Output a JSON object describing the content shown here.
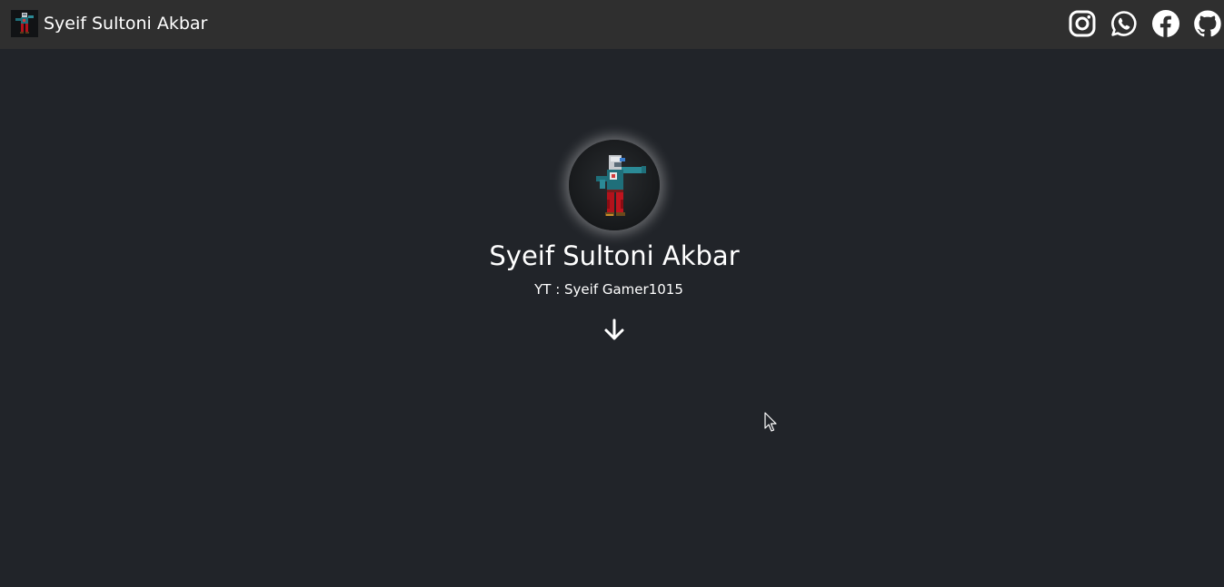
{
  "navbar": {
    "brand_title": "Syeif Sultoni Akbar",
    "brand_logo_icon": "pixel-character-avatar",
    "social_links": [
      {
        "name": "instagram",
        "icon": "instagram-icon"
      },
      {
        "name": "whatsapp",
        "icon": "whatsapp-icon"
      },
      {
        "name": "facebook",
        "icon": "facebook-icon"
      },
      {
        "name": "github",
        "icon": "github-icon"
      }
    ]
  },
  "hero": {
    "name": "Syeif Sultoni Akbar",
    "subtitle": "YT : Syeif Gamer1015",
    "scroll_icon": "arrow-down-icon"
  },
  "colors": {
    "background": "#212429",
    "navbar": "#2f2f2f",
    "text": "#ffffff",
    "avatar_glow": "#ffffff"
  }
}
